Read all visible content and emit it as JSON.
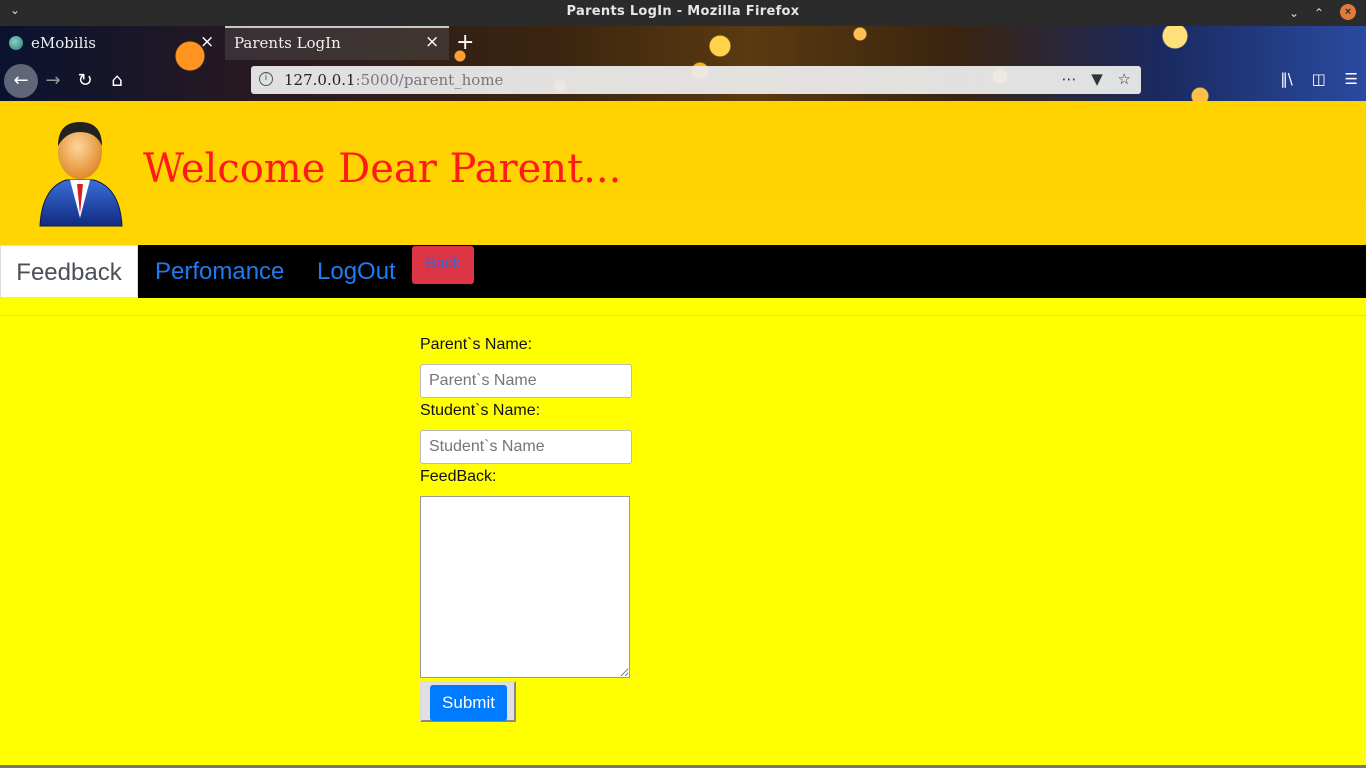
{
  "window": {
    "title": "Parents LogIn - Mozilla Firefox"
  },
  "tabs": [
    {
      "label": "eMobilis"
    },
    {
      "label": "Parents LogIn"
    }
  ],
  "urlbar": {
    "host": "127.0.0.1",
    "path": ":5000/parent_home"
  },
  "header": {
    "welcome": "Welcome Dear Parent..."
  },
  "nav": {
    "feedback": "Feedback",
    "performance": "Perfomance",
    "logout": "LogOut",
    "back": "Back"
  },
  "form": {
    "parent_label": "Parent`s Name:",
    "parent_placeholder": "Parent`s Name",
    "student_label": "Student`s Name:",
    "student_placeholder": "Student`s Name",
    "feedback_label": "FeedBack:",
    "submit_label": "Submit"
  },
  "colors": {
    "page_bg": "#ffff00",
    "header_bg": "#ffd200",
    "welcome_text": "#ff1a1a",
    "navbar_bg": "#000000",
    "nav_link": "#1e7cf0",
    "back_button": "#dc3545",
    "submit_button": "#007bff"
  }
}
